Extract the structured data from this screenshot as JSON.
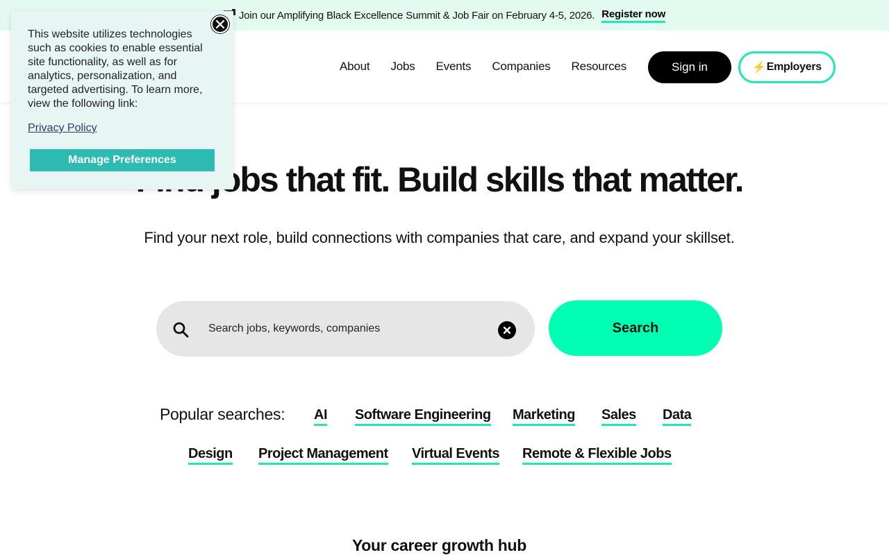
{
  "announcement": {
    "text": "Join our Amplifying Black Excellence Summit & Job Fair on February 4-5, 2026.",
    "link": "Register now"
  },
  "nav": {
    "items": [
      "About",
      "Jobs",
      "Events",
      "Companies",
      "Resources"
    ],
    "signin": "Sign in",
    "employers_icon": "⚡",
    "employers": "Employers"
  },
  "hero": {
    "title": "Find jobs that fit. Build skills that matter.",
    "subtitle": "Find your next role, build connections with companies that care, and expand your skillset."
  },
  "search": {
    "placeholder": "Search jobs, keywords, companies",
    "button": "Search"
  },
  "popular": {
    "label": "Popular searches:",
    "items": [
      "AI",
      "Software Engineering",
      "Marketing",
      "Sales",
      "Data",
      "Design",
      "Project Management",
      "Virtual Events",
      "Remote & Flexible Jobs"
    ]
  },
  "hub": {
    "title": "Your career growth hub"
  },
  "cookie": {
    "text": "This website utilizes technologies such as cookies to enable essential site functionality, as well as for analytics, personalization, and targeted advertising. To learn more, view the following link:",
    "link": "Privacy Policy",
    "button": "Manage Preferences"
  },
  "colors": {
    "accent": "#00ffb3",
    "underline": "#1de9b6",
    "cookie_bg": "#e7f5f3",
    "cookie_button": "#2cbab2",
    "announce_bg": "#e3faf1"
  }
}
